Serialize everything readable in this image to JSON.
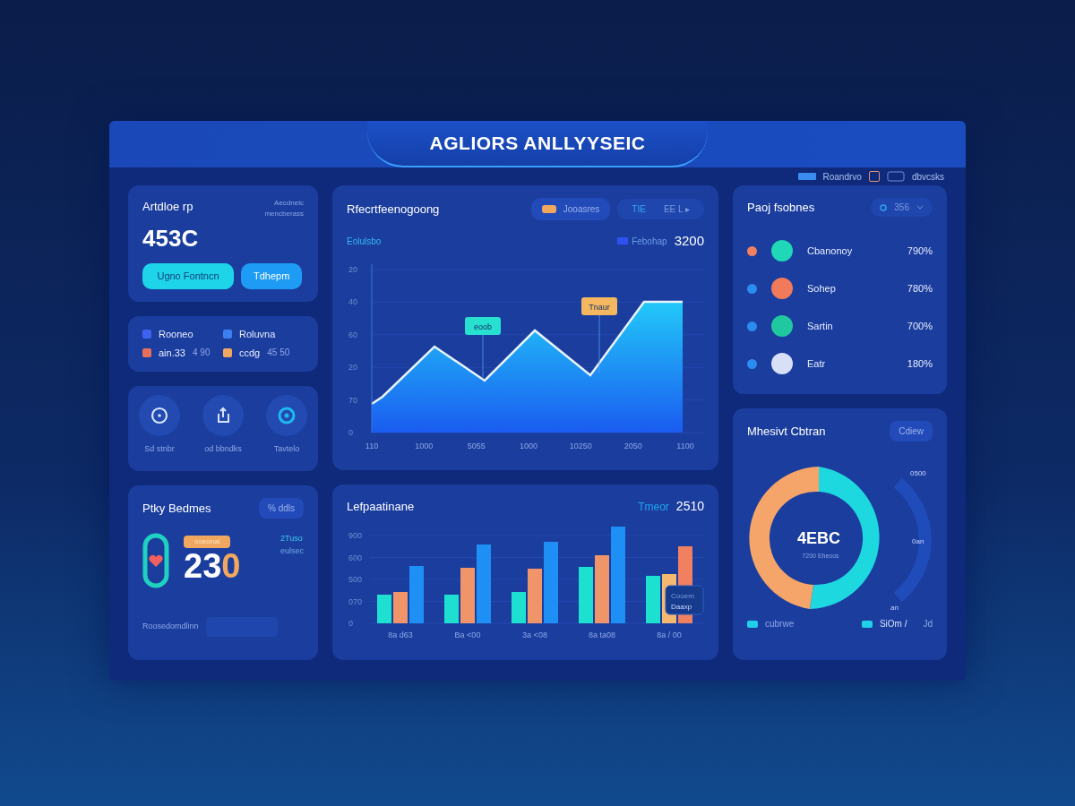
{
  "window": {
    "title": "AGLIORS ANLLYYSEIC"
  },
  "toolbar": {
    "label": "Roandrvo",
    "checkbox": {
      "checked": false
    },
    "extra": "dbvcsks"
  },
  "kpi_card": {
    "title": "Artdloe rp",
    "notes": [
      "Aecdnelc",
      "mencberass"
    ],
    "value": "453C",
    "buttons": [
      {
        "label": "Ugno Fontncn",
        "kind": "teal"
      },
      {
        "label": "Tdhepm",
        "kind": "blue"
      }
    ]
  },
  "legend_card": {
    "items": [
      {
        "label": "Rooneo",
        "color": "#3d63f0"
      },
      {
        "label": "Roluvna",
        "color": "#3d7ef0"
      },
      {
        "label": "ain.33",
        "sub": "4 90",
        "color": "#e8705a"
      },
      {
        "label": "ccdg",
        "sub": "45 50",
        "color": "#f0a860"
      }
    ]
  },
  "shortcuts": [
    {
      "label": "Sd stnbr",
      "kind": "clock"
    },
    {
      "label": "od bbndks",
      "kind": "share"
    },
    {
      "label": "Tavtelo",
      "kind": "target"
    }
  ],
  "health_card": {
    "title": "Ptky Bedmes",
    "button": "% ddls",
    "badge": "ooeonal",
    "value": "23",
    "value_accent": "0",
    "side": [
      "2Tuso",
      "eulsec"
    ],
    "footer": "Roosedomdlinn"
  },
  "trend_card": {
    "title": "Rfecrtfeenogoong",
    "chip": "Jooasres",
    "buttons": [
      "TIE",
      "EE L ▸"
    ],
    "subtitle": "Eolulsbo",
    "total_label": "Febohap",
    "total": "3200",
    "yticks": [
      "20",
      "40",
      "60",
      "20",
      "70",
      "0"
    ],
    "xticks": [
      "110",
      "1000",
      "5055",
      "1000",
      "10250",
      "2050",
      "1100"
    ],
    "callouts": [
      {
        "text": "eoob",
        "color": "#28e0d0"
      },
      {
        "text": "Tnaur",
        "color": "#f5b860"
      }
    ]
  },
  "projects_card": {
    "title": "Paoj fsobnes",
    "control": "356",
    "items": [
      {
        "name": "Cbanonoy",
        "value": "790%",
        "color": "#f08060",
        "avatar": {
          "color": "#20d8b8"
        }
      },
      {
        "name": "Sohep",
        "value": "780%",
        "color": "#2a8cf0",
        "avatar": {
          "color": "#f07a5a"
        }
      },
      {
        "name": "Sartin",
        "value": "700%",
        "color": "#2a8cf0",
        "avatar": {
          "color": "#20c8a0"
        }
      },
      {
        "name": "Eatr",
        "value": "180%",
        "color": "#2a8cf0",
        "avatar": {
          "color": "#d8e0f8"
        }
      }
    ]
  },
  "bars_card": {
    "title": "Lefpaatinane",
    "total_label": "Tmeor",
    "total": "2510",
    "yticks": [
      "900",
      "600",
      "500",
      "070",
      "0"
    ],
    "xticks": [
      "8a d63",
      "Ba <00",
      "3a <08",
      "8a ta08",
      "8a / 00"
    ],
    "tooltip": [
      "Cooem",
      "Daaxp"
    ]
  },
  "donut_card": {
    "title": "Mhesivt Cbtran",
    "button": "Cdiew",
    "center": "4EBC",
    "center_sub": "7200 Eheoos",
    "callouts": [
      "0500",
      "0an",
      "an"
    ],
    "legend": [
      {
        "label": "cubrwe",
        "color": "#20d0e8"
      },
      {
        "label": "SiOm /",
        "color": "#20d0e8"
      }
    ],
    "legend_extra": "Jd"
  }
}
